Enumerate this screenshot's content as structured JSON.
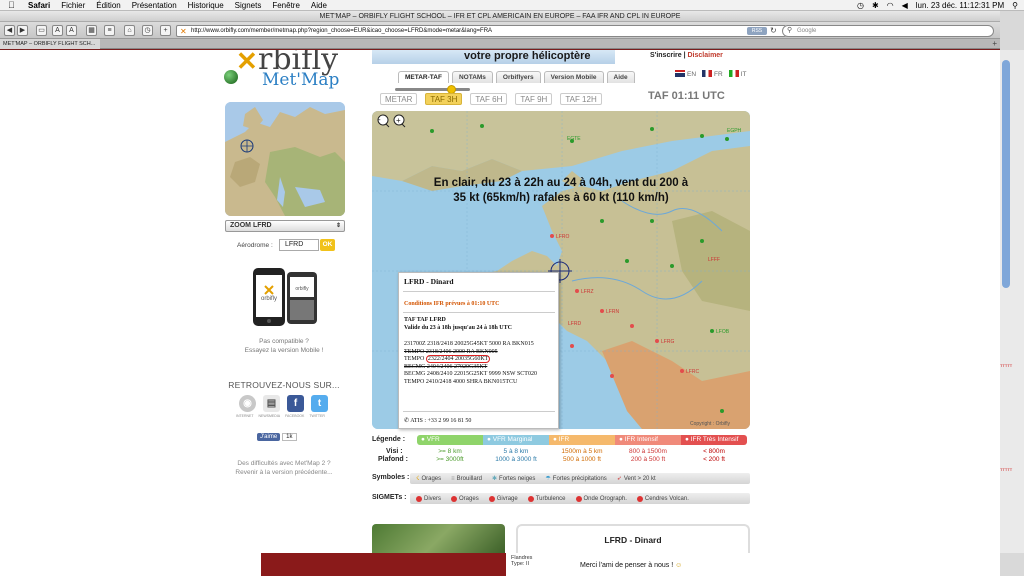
{
  "menubar": {
    "apple": "",
    "items": [
      "Safari",
      "Fichier",
      "Édition",
      "Présentation",
      "Historique",
      "Signets",
      "Fenêtre",
      "Aide"
    ],
    "clock": "lun. 23 déc.  11:12:31 PM"
  },
  "window": {
    "title": "MET'MAP – ORBIFLY FLIGHT SCHOOL – IFR ET CPL AMERICAIN EN EUROPE – FAA IFR AND CPL IN EUROPE",
    "url": "http://www.orbifly.com/member/metmap.php?region_choose=EUR&icao_choose=LFRD&mode=metar&lang=FRA",
    "rss": "RSS",
    "search_placeholder": "Google",
    "tab_label": "MET'MAP – ORBIFLY FLIGHT SCH..."
  },
  "logo": {
    "brand": "rbifly",
    "tagline": "Met'Map"
  },
  "left": {
    "zoom_select": "ZOOM LFRD",
    "aerodrome_label": "Aérodrome :",
    "aerodrome_value": "LFRD",
    "ok": "OK",
    "compat": "Pas compatible ?\nEssayez la version Mobile !",
    "retrouvez": "RETROUVEZ-NOUS SUR...",
    "social_labels": [
      "INTERNET",
      "NEWSMEDIA",
      "FACEBOOK",
      "TWITTER"
    ],
    "like": "J'aime",
    "like_count": "1k",
    "difficulty": "Des difficultés avec Met'Map 2 ?\nRevenir à la version précédente..."
  },
  "header": {
    "banner": "votre propre hélicoptère",
    "signup": "S'inscrire",
    "disclaimer": "Disclaimer",
    "tabs": [
      "METAR-TAF",
      "NOTAMs",
      "Orbiflyers",
      "Version Mobile",
      "Aide"
    ],
    "langs": [
      "EN",
      "FR",
      "IT"
    ]
  },
  "taf": {
    "buttons": [
      "METAR",
      "TAF 3H",
      "TAF 6H",
      "TAF 9H",
      "TAF 12H"
    ],
    "active": 1,
    "time": "TAF 01:11 UTC"
  },
  "map": {
    "headline": "En clair, du 23 à 22h au 24 à 04h, vent du 200 à\n35 kt (65km/h) rafales à 60 kt (110 km/h)",
    "labels": [
      "EGTE",
      "EGPH",
      "LFRO",
      "LFRZ",
      "LFRN",
      "LFRD",
      "LFRG",
      "LFRC",
      "LFFF",
      "LFOB"
    ],
    "copyright": "Copyright : Orbifly"
  },
  "popup": {
    "title": "LFRD - Dinard",
    "warning": "Conditions IFR prévues à 01:10 UTC",
    "taf_title": "TAF TAF LFRD",
    "validity": "Valide du 23 à 18h jusqu'au 24 à 18h UTC",
    "raw_1": "231700Z 2318/2418 20025G45KT 5000 RA BKN015",
    "raw_2": "TEMPO 2318/2406 2000 RA BKN005",
    "raw_3_prefix": "TEMPO ",
    "raw_3_circled": "2322/2404 20035G60KT",
    "raw_4": "BECMG 2404/2406 27020G35KT",
    "raw_5": "BECMG 2408/2410 22015G25KT 9999 NSW SCT020",
    "raw_6": "TEMPO 2410/2418 4000 SHRA BKN015TCU",
    "atis": "ATIS : +33 2 99 16 81 50"
  },
  "legend": {
    "label": "Légende :",
    "visi_label": "Visi :",
    "plafond_label": "Plafond :",
    "cats": [
      {
        "name": "VFR",
        "color": "#8fd46a",
        "visi": ">= 8 km",
        "plafond": ">= 3000ft",
        "vcolor": "#4a9a2a"
      },
      {
        "name": "VFR Marginal",
        "color": "#8ecae0",
        "visi": "5 à 8 km",
        "plafond": "1000 à 3000 ft",
        "vcolor": "#2a7aa8"
      },
      {
        "name": "IFR",
        "color": "#f5b96c",
        "visi": "1500m à 5 km",
        "plafond": "500 à 1000 ft",
        "vcolor": "#d06a00"
      },
      {
        "name": "IFR Intensif",
        "color": "#f08a7a",
        "visi": "800 à 1500m",
        "plafond": "200 à 500 ft",
        "vcolor": "#c33"
      },
      {
        "name": "IFR Très Intensif",
        "color": "#e35050",
        "visi": "< 800m",
        "plafond": "< 200 ft",
        "vcolor": "#b00"
      }
    ],
    "symboles_label": "Symboles :",
    "symboles": [
      "Orages",
      "Brouillard",
      "Fortes neiges",
      "Fortes précipitations",
      "Vent > 20 kt"
    ],
    "sigmets_label": "SIGMETs :",
    "sigmets": [
      "Divers",
      "Orages",
      "Givrage",
      "Turbulence",
      "Onde Orograph.",
      "Cendres Volcan."
    ]
  },
  "bottom": {
    "title": "LFRD - Dinard"
  },
  "behind": {
    "flan_1": "Flandres",
    "flan_2": "Type: II",
    "merci": "Merci l'ami de penser à nous !",
    "side_1": "TTTTT",
    "side_2": "TTTTT"
  }
}
